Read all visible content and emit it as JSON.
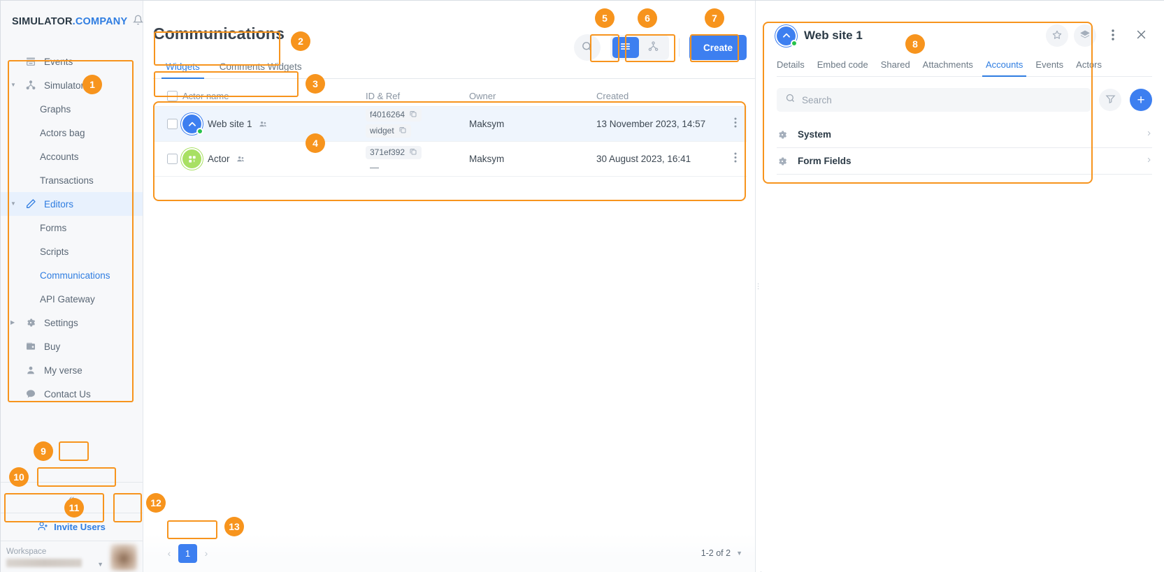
{
  "sidebar": {
    "brand": {
      "name": "SIMULATOR",
      "suffix": ".COMPANY"
    },
    "bell_icon": "bell-icon",
    "items": [
      {
        "label": "Events",
        "icon": "events-icon",
        "level": 0,
        "caret": "",
        "state": ""
      },
      {
        "label": "Simulator",
        "icon": "simulator-icon",
        "level": 0,
        "caret": "down",
        "state": ""
      },
      {
        "label": "Graphs",
        "icon": "",
        "level": 1,
        "caret": "",
        "state": ""
      },
      {
        "label": "Actors bag",
        "icon": "",
        "level": 1,
        "caret": "",
        "state": ""
      },
      {
        "label": "Accounts",
        "icon": "",
        "level": 1,
        "caret": "",
        "state": ""
      },
      {
        "label": "Transactions",
        "icon": "",
        "level": 1,
        "caret": "",
        "state": ""
      },
      {
        "label": "Editors",
        "icon": "pencil-icon",
        "level": 0,
        "caret": "down",
        "state": "active"
      },
      {
        "label": "Forms",
        "icon": "",
        "level": 1,
        "caret": "",
        "state": ""
      },
      {
        "label": "Scripts",
        "icon": "",
        "level": 1,
        "caret": "",
        "state": ""
      },
      {
        "label": "Communications",
        "icon": "",
        "level": 1,
        "caret": "",
        "state": "link-active"
      },
      {
        "label": "API Gateway",
        "icon": "",
        "level": 1,
        "caret": "",
        "state": ""
      },
      {
        "label": "Settings",
        "icon": "gear-icon",
        "level": 0,
        "caret": "right",
        "state": ""
      },
      {
        "label": "Buy",
        "icon": "buy-icon",
        "level": 0,
        "caret": "",
        "state": ""
      },
      {
        "label": "My verse",
        "icon": "user-icon",
        "level": 0,
        "caret": "",
        "state": ""
      },
      {
        "label": "Contact Us",
        "icon": "chat-icon",
        "level": 0,
        "caret": "",
        "state": ""
      }
    ],
    "collapse_label": "«",
    "invite_label": "Invite Users",
    "workspace_label": "Workspace",
    "workspace_value": ""
  },
  "main": {
    "title": "Communications",
    "tabs": [
      {
        "label": "Widgets",
        "active": true
      },
      {
        "label": "Comments Widgets",
        "active": false
      }
    ],
    "toolbar": {
      "search_icon": "search-icon",
      "view_list_icon": "list-view-icon",
      "view_tree_icon": "tree-view-icon",
      "create_label": "Create"
    },
    "table": {
      "columns": [
        "Actor name",
        "ID & Ref",
        "Owner",
        "Created"
      ],
      "rows": [
        {
          "name": "Web site 1",
          "avatar": "blue-chevron-avatar",
          "online": true,
          "id": "f4016264",
          "ref": "widget",
          "owner": "Maksym",
          "created": "13 November 2023, 14:57",
          "selected": true
        },
        {
          "name": "Actor",
          "avatar": "green-grid-avatar",
          "online": false,
          "id": "371ef392",
          "ref": "—",
          "owner": "Maksym",
          "created": "30 August 2023, 16:41",
          "selected": false
        }
      ]
    },
    "footer": {
      "prev_label": "‹",
      "page": "1",
      "next_label": "›",
      "range": "1-2 of 2"
    }
  },
  "rightpanel": {
    "title": "Web site 1",
    "avatar": "blue-chevron-avatar",
    "actions": [
      "star-icon",
      "layers-icon",
      "kebab-icon",
      "close-icon"
    ],
    "tabs": [
      {
        "label": "Details",
        "active": false
      },
      {
        "label": "Embed code",
        "active": false
      },
      {
        "label": "Shared",
        "active": false
      },
      {
        "label": "Attachments",
        "active": false
      },
      {
        "label": "Accounts",
        "active": true
      },
      {
        "label": "Events",
        "active": false
      },
      {
        "label": "Actors",
        "active": false
      }
    ],
    "search_placeholder": "Search",
    "search_value": "",
    "filter_icon": "filter-icon",
    "add_label": "+",
    "list": [
      {
        "label": "System",
        "icon": "gear-icon"
      },
      {
        "label": "Form Fields",
        "icon": "gear-icon"
      }
    ]
  },
  "callouts": [
    {
      "n": "1"
    },
    {
      "n": "2"
    },
    {
      "n": "3"
    },
    {
      "n": "4"
    },
    {
      "n": "5"
    },
    {
      "n": "6"
    },
    {
      "n": "7"
    },
    {
      "n": "8"
    },
    {
      "n": "9"
    },
    {
      "n": "10"
    },
    {
      "n": "11"
    },
    {
      "n": "12"
    },
    {
      "n": "13"
    }
  ],
  "colors": {
    "accent": "#3d7ff0",
    "callout": "#f7941d",
    "online": "#27c24c"
  }
}
